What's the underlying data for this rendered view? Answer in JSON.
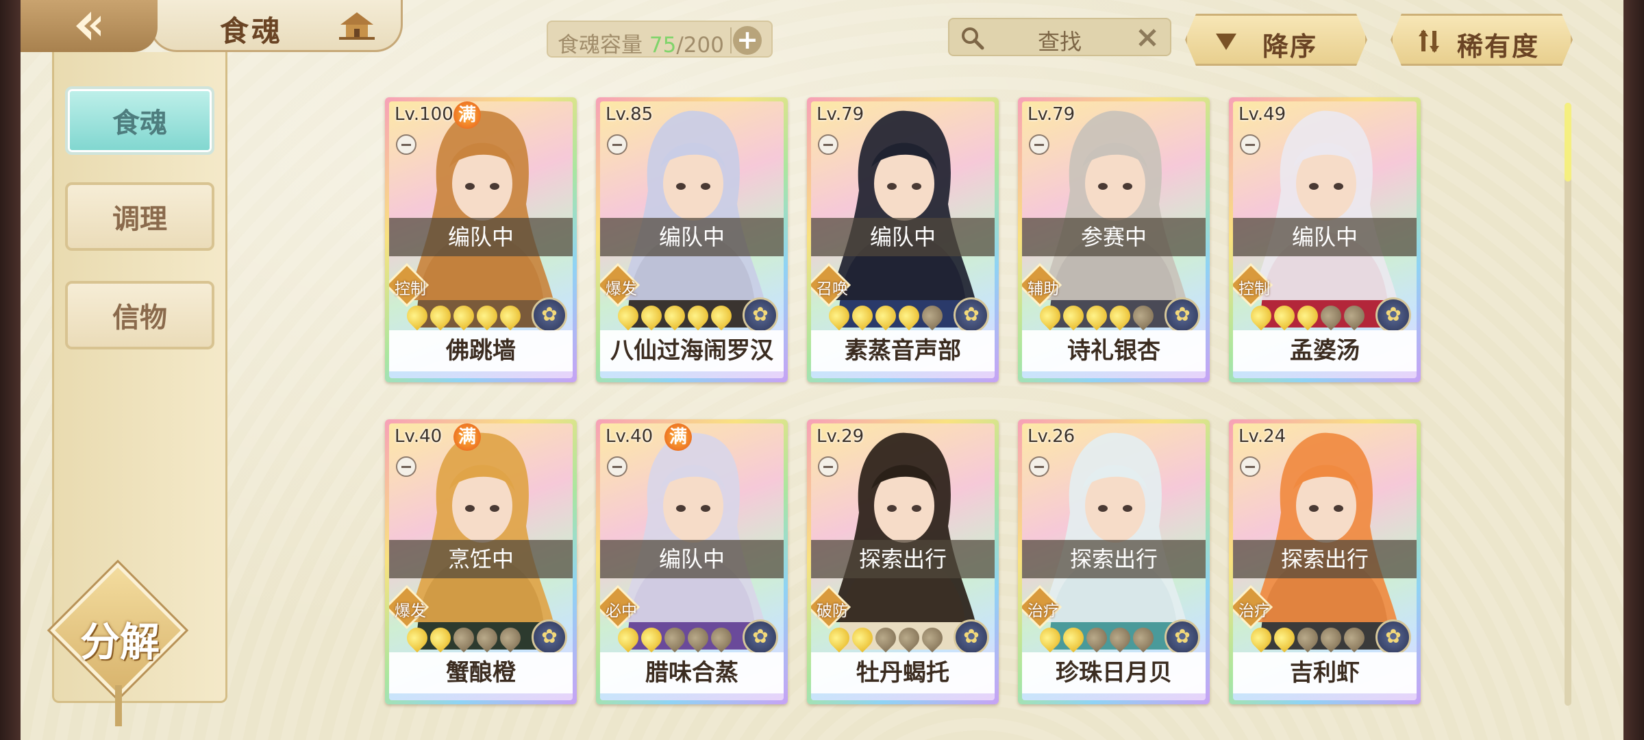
{
  "header": {
    "title": "食魂",
    "capacity_label": "食魂容量",
    "capacity_current": "75",
    "capacity_max": "/200",
    "capacity_add": "+",
    "search_text": "查找",
    "sort_label": "降序",
    "rarity_label": "稀有度"
  },
  "sidebar": {
    "items": [
      {
        "label": "食魂",
        "active": true
      },
      {
        "label": "调理",
        "active": false
      },
      {
        "label": "信物",
        "active": false
      }
    ],
    "decompose_label": "分解"
  },
  "cards": [
    {
      "level": "Lv.100",
      "max": "满",
      "status": "编队中",
      "role": "控制",
      "stars": 5,
      "name": "佛跳墙",
      "hair": "#c9843e",
      "outfit": "#7a5a3a"
    },
    {
      "level": "Lv.85",
      "max": "",
      "status": "编队中",
      "role": "爆发",
      "stars": 5,
      "name": "八仙过海闹罗汉",
      "hair": "#c9cde6",
      "outfit": "#3a3430"
    },
    {
      "level": "Lv.79",
      "max": "",
      "status": "编队中",
      "role": "召唤",
      "stars": 4,
      "name": "素蒸音声部",
      "hair": "#1f2230",
      "outfit": "#2a3a6a"
    },
    {
      "level": "Lv.79",
      "max": "",
      "status": "参赛中",
      "role": "辅助",
      "stars": 4,
      "name": "诗礼银杏",
      "hair": "#c9c2ba",
      "outfit": "#4a4a56"
    },
    {
      "level": "Lv.49",
      "max": "",
      "status": "编队中",
      "role": "控制",
      "stars": 3,
      "name": "孟婆汤",
      "hair": "#ece8ef",
      "outfit": "#b3263a"
    },
    {
      "level": "Lv.40",
      "max": "满",
      "status": "烹饪中",
      "role": "爆发",
      "stars": 2,
      "name": "蟹酿橙",
      "hair": "#e0a448",
      "outfit": "#2c3a2e"
    },
    {
      "level": "Lv.40",
      "max": "满",
      "status": "编队中",
      "role": "必中",
      "stars": 2,
      "name": "腊味合蒸",
      "hair": "#d9d6e8",
      "outfit": "#6a4a9a"
    },
    {
      "level": "Lv.29",
      "max": "",
      "status": "探索出行",
      "role": "破防",
      "stars": 2,
      "name": "牡丹蝎托",
      "hair": "#2a2018",
      "outfit": "#e8dcc0"
    },
    {
      "level": "Lv.26",
      "max": "",
      "status": "探索出行",
      "role": "治疗",
      "stars": 2,
      "name": "珍珠日月贝",
      "hair": "#e4eef0",
      "outfit": "#4a9a9a"
    },
    {
      "level": "Lv.24",
      "max": "",
      "status": "探索出行",
      "role": "治疗",
      "stars": 2,
      "name": "吉利虾",
      "hair": "#f08a40",
      "outfit": "#3a3a3a"
    }
  ],
  "colors": {
    "accent_teal": "#7fd6cf",
    "panel": "#efe9d2",
    "gold": "#e5b21d"
  },
  "icons": [
    "back-arrow-icon",
    "house-icon",
    "search-icon",
    "clear-icon",
    "sort-desc-icon",
    "rarity-sort-icon"
  ]
}
